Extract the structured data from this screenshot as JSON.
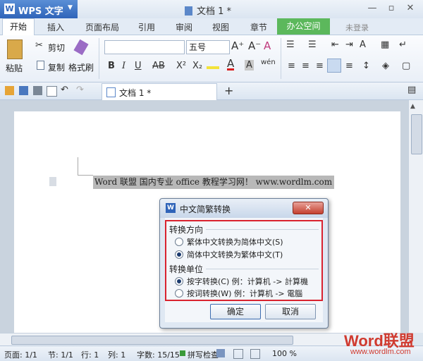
{
  "app": {
    "name": "WPS 文字",
    "doc_title": "文档 1 *"
  },
  "window": {
    "minimize": "—",
    "restore": "▫",
    "close": "✕"
  },
  "tabs": [
    "开始",
    "插入",
    "页面布局",
    "引用",
    "审阅",
    "视图",
    "章节",
    "办公空间"
  ],
  "account": {
    "not_logged_in": "未登录",
    "help": "?"
  },
  "ribbon": {
    "paste": "粘贴",
    "cut": "剪切",
    "copy": "复制",
    "format_painter": "格式刷",
    "font_name": "",
    "font_size": "五号",
    "bold": "B",
    "italic": "I",
    "underline": "U",
    "strikethrough": "AB",
    "superscript": "X²",
    "subscript": "X₂"
  },
  "quickbar": {
    "doc_tab": "文档 1 *",
    "add_tab": "+"
  },
  "document": {
    "text": "Word 联盟  国内专业 office 教程学习网！ www.wordlm.com"
  },
  "dialog": {
    "title": "中文简繁转换",
    "group1": "转换方向",
    "opt_t2s": "繁体中文转换为简体中文(S)",
    "opt_s2t": "简体中文转换为繁体中文(T)",
    "group2": "转换单位",
    "opt_char": "按字转换(C)  例：计算机 -> 計算機",
    "opt_word": "按词转换(W)  例：计算机 -> 電腦",
    "ok": "确定",
    "cancel": "取消",
    "selected_direction": "简体中文转换为繁体中文(T)",
    "selected_unit": "按字转换(C)"
  },
  "status": {
    "page": "页面: 1/1",
    "section": "节: 1/1",
    "row": "行: 1",
    "col": "列: 1",
    "words": "字数: 15/15",
    "spell": "拼写检查",
    "zoom": "100 %"
  },
  "watermark": {
    "brand": "Word联盟",
    "url": "www.wordlm.com"
  }
}
